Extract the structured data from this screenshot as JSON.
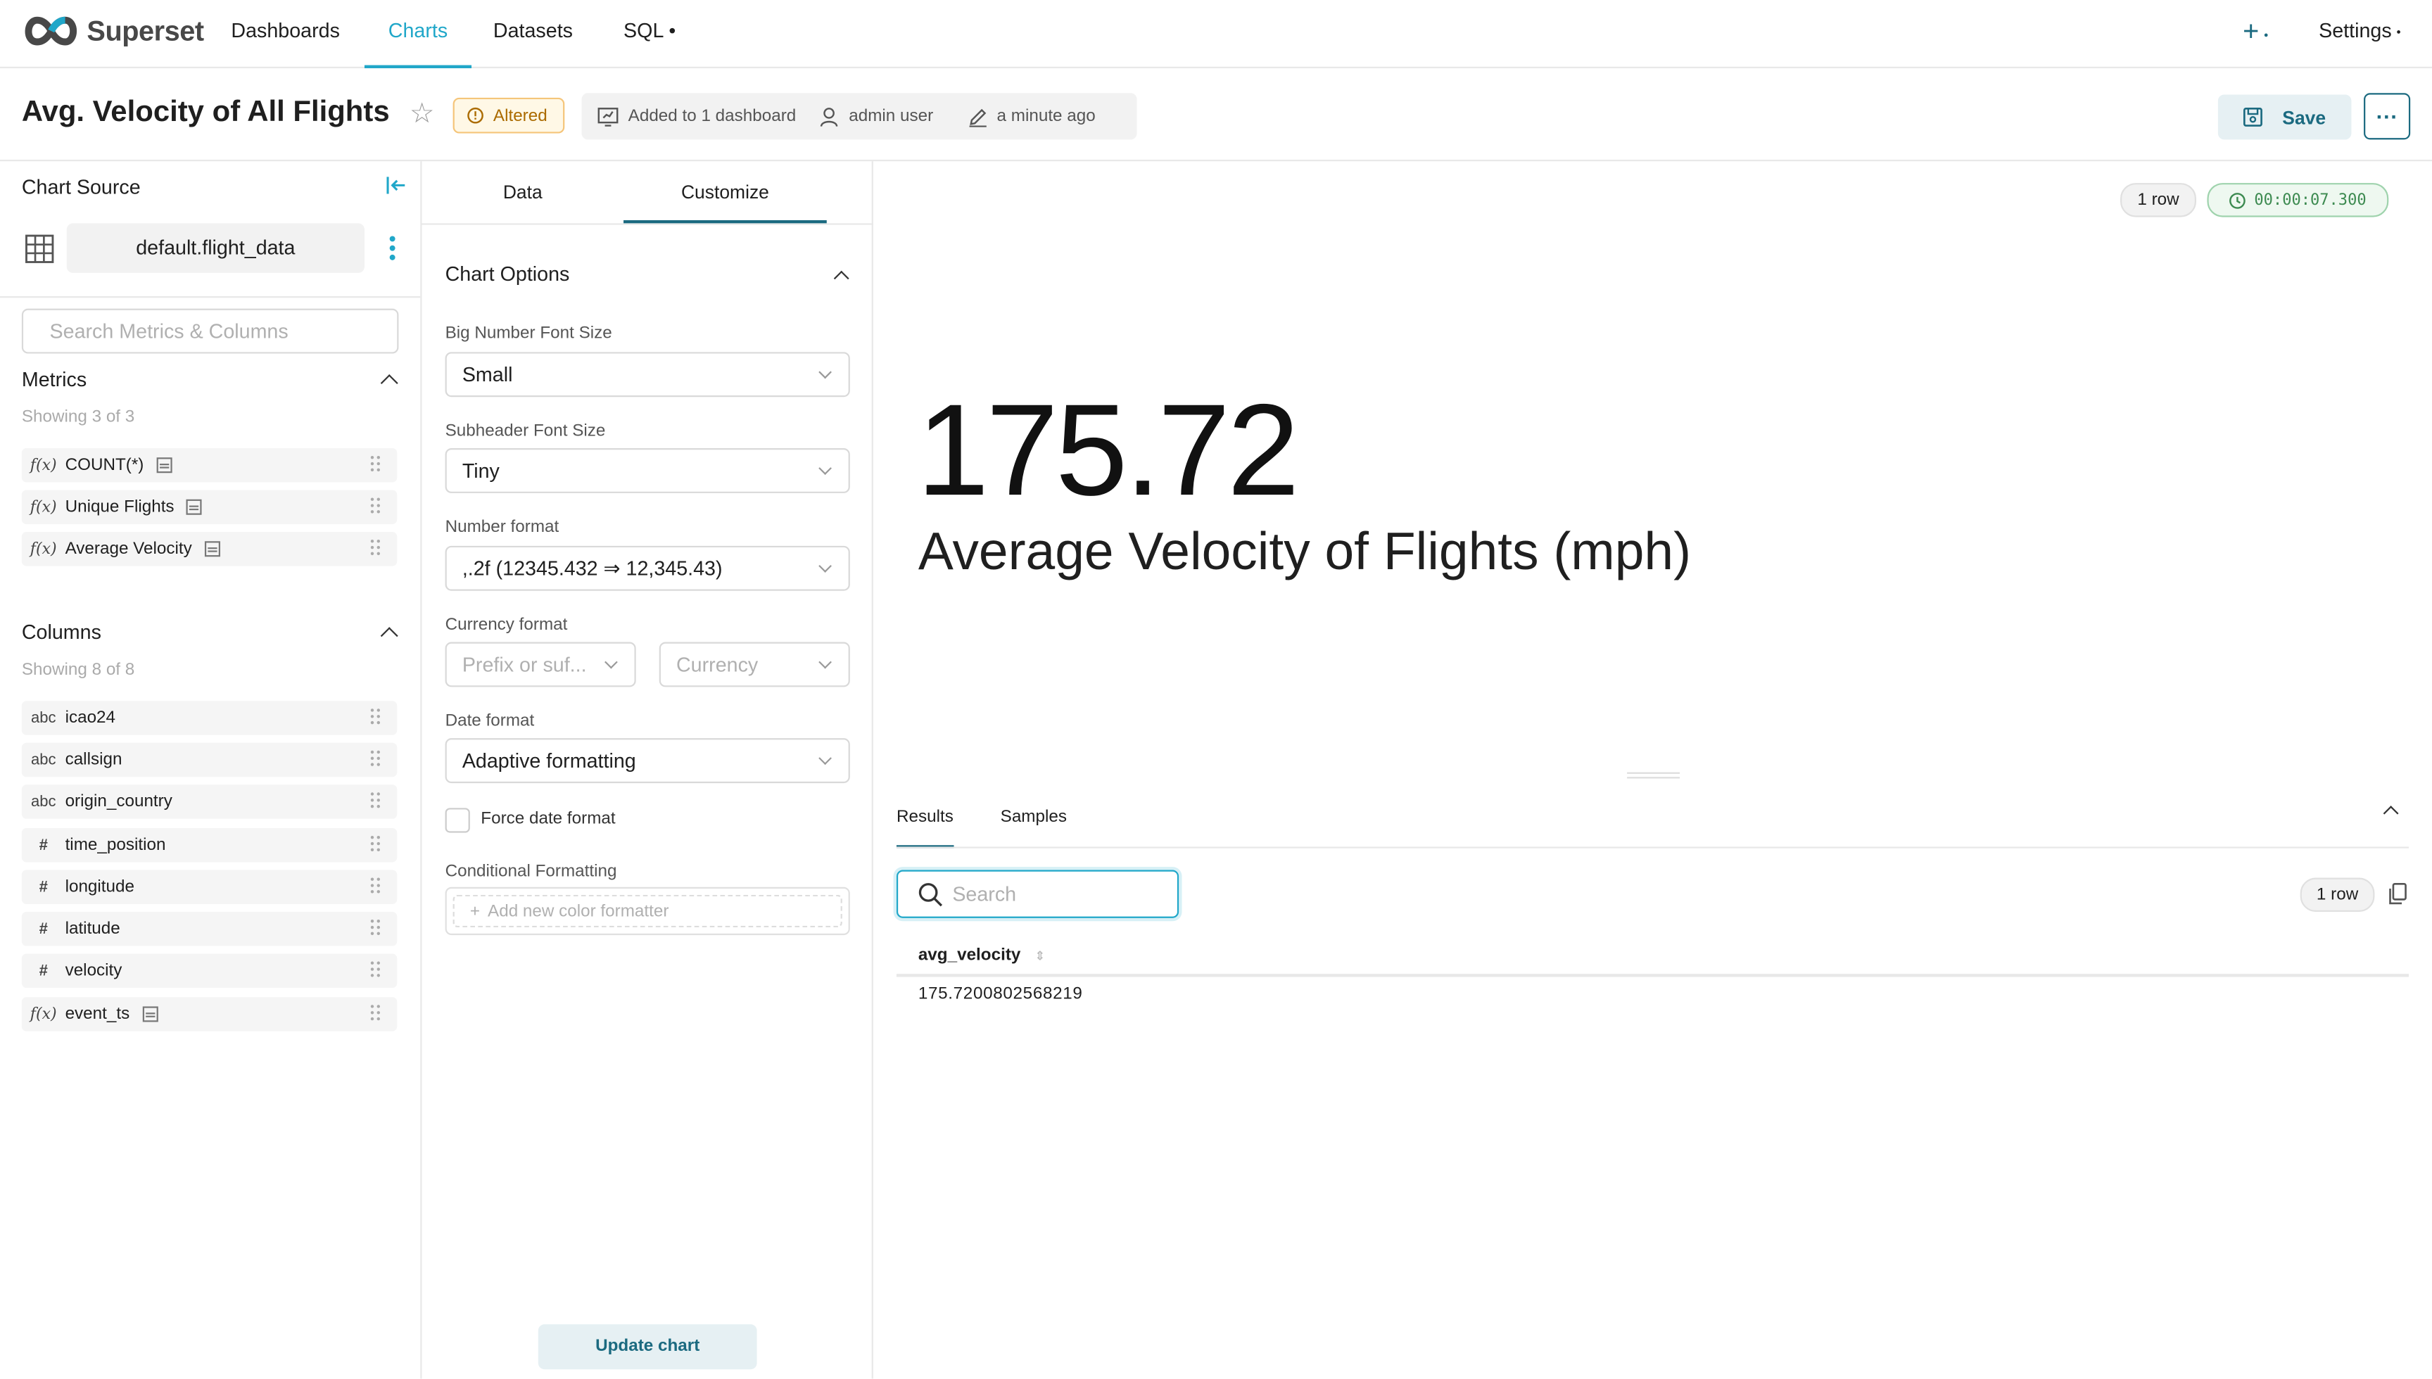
{
  "app": {
    "logo_text": "Superset",
    "nav": [
      {
        "label": "Dashboards"
      },
      {
        "label": "Charts"
      },
      {
        "label": "Datasets"
      },
      {
        "label": "SQL"
      }
    ],
    "settings_label": "Settings",
    "accent_color": "#20a7c9",
    "primary_color": "#1b6a80"
  },
  "header": {
    "title": "Avg. Velocity of All Flights",
    "altered_label": "Altered",
    "dashboards_label": "Added to 1 dashboard",
    "owner_label": "admin user",
    "modified_label": "a minute ago",
    "save_label": "Save"
  },
  "source": {
    "title": "Chart Source",
    "dataset_name": "default.flight_data",
    "search_placeholder": "Search Metrics & Columns",
    "metrics_title": "Metrics",
    "metrics_count": "Showing 3 of 3",
    "metrics": [
      {
        "type": "f(x)",
        "name": "COUNT(*)"
      },
      {
        "type": "f(x)",
        "name": "Unique Flights"
      },
      {
        "type": "f(x)",
        "name": "Average Velocity"
      }
    ],
    "columns_title": "Columns",
    "columns_count": "Showing 8 of 8",
    "columns": [
      {
        "type": "abc",
        "name": "icao24"
      },
      {
        "type": "abc",
        "name": "callsign"
      },
      {
        "type": "abc",
        "name": "origin_country"
      },
      {
        "type": "#",
        "name": "time_position"
      },
      {
        "type": "#",
        "name": "longitude"
      },
      {
        "type": "#",
        "name": "latitude"
      },
      {
        "type": "#",
        "name": "velocity"
      },
      {
        "type": "f(x)",
        "name": "event_ts"
      }
    ]
  },
  "controls": {
    "tab_data": "Data",
    "tab_customize": "Customize",
    "section_title": "Chart Options",
    "big_number_font_size_label": "Big Number Font Size",
    "big_number_font_size_value": "Small",
    "subheader_font_size_label": "Subheader Font Size",
    "subheader_font_size_value": "Tiny",
    "number_format_label": "Number format",
    "number_format_value": ",.2f (12345.432 ⇒ 12,345.43)",
    "currency_format_label": "Currency format",
    "currency_prefix_placeholder": "Prefix or suf...",
    "currency_placeholder": "Currency",
    "date_format_label": "Date format",
    "date_format_value": "Adaptive formatting",
    "force_date_format_label": "Force date format",
    "conditional_formatting_label": "Conditional Formatting",
    "add_formatter_label": "Add new color formatter",
    "update_chart_label": "Update chart"
  },
  "result": {
    "row_badge": "1 row",
    "time_badge": "00:00:07.300",
    "big_number": "175.72",
    "subheader": "Average Velocity of Flights (mph)",
    "tab_results": "Results",
    "tab_samples": "Samples",
    "search_placeholder": "Search",
    "rows_badge": "1 row",
    "column_header": "avg_velocity",
    "cell_value": "175.7200802568219"
  }
}
